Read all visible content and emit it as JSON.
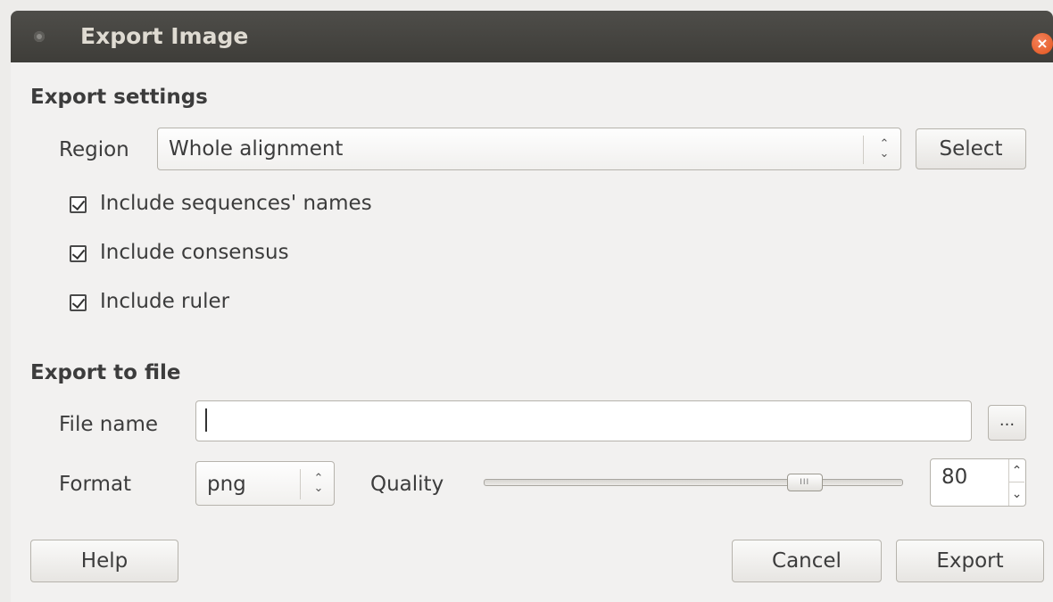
{
  "window": {
    "title": "Export Image",
    "close_icon": "close-icon"
  },
  "export_settings": {
    "heading": "Export settings",
    "region_label": "Region",
    "region_value": "Whole alignment",
    "select_button": "Select",
    "checkboxes": [
      {
        "label": "Include sequences' names",
        "checked": true
      },
      {
        "label": "Include consensus",
        "checked": true
      },
      {
        "label": "Include ruler",
        "checked": true
      }
    ]
  },
  "export_to_file": {
    "heading": "Export to file",
    "file_name_label": "File name",
    "file_name_value": "",
    "browse_button": "...",
    "format_label": "Format",
    "format_value": "png",
    "quality_label": "Quality",
    "quality_value": "80",
    "quality_slider_fraction": 0.79
  },
  "buttons": {
    "help": "Help",
    "cancel": "Cancel",
    "export": "Export"
  },
  "colors": {
    "titlebar": "#3e3d39",
    "close": "#e2541b",
    "background": "#f2f1f0"
  }
}
